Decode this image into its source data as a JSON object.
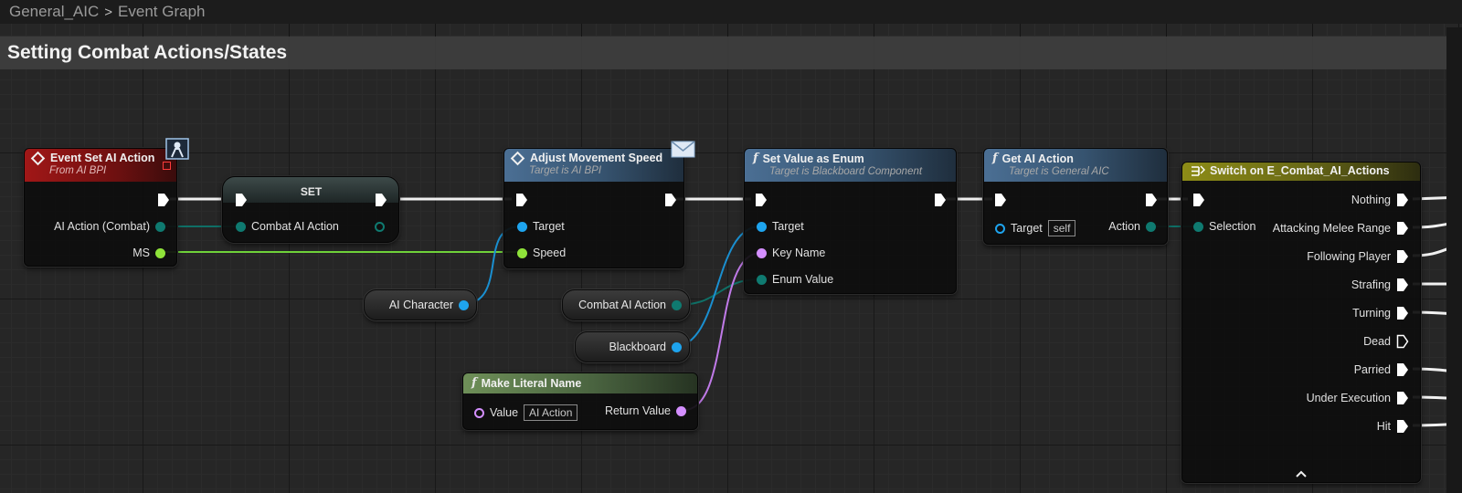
{
  "breadcrumb": {
    "graph_name": "General_AIC",
    "separator": ">",
    "current": "Event Graph"
  },
  "comment": {
    "title": "Setting Combat Actions/States"
  },
  "nodes": {
    "event_set_ai_action": {
      "title": "Event Set AI Action",
      "subtitle": "From AI BPI",
      "pins": {
        "ai_action": "AI Action (Combat)",
        "ms": "MS"
      }
    },
    "set_node": {
      "title": "SET",
      "pins": {
        "combat_ai_action": "Combat AI Action"
      }
    },
    "adjust_movement_speed": {
      "title": "Adjust Movement Speed",
      "subtitle": "Target is AI BPI",
      "pins": {
        "target": "Target",
        "speed": "Speed"
      }
    },
    "set_value_as_enum": {
      "title": "Set Value as Enum",
      "subtitle": "Target is Blackboard Component",
      "pins": {
        "target": "Target",
        "key_name": "Key Name",
        "enum_value": "Enum Value"
      }
    },
    "get_ai_action": {
      "title": "Get AI Action",
      "subtitle": "Target is General AIC",
      "pins": {
        "target": "Target",
        "target_value": "self",
        "action": "Action"
      }
    },
    "switch_node": {
      "title": "Switch on E_Combat_AI_Actions",
      "selection": "Selection",
      "outputs": [
        "Nothing",
        "Attacking Melee Range",
        "Following Player",
        "Strafing",
        "Turning",
        "Dead",
        "Parried",
        "Under Execution",
        "Hit"
      ]
    },
    "make_literal_name": {
      "title": "Make Literal Name",
      "pins": {
        "value": "Value",
        "value_default": "AI Action",
        "return_value": "Return Value"
      }
    },
    "var_ai_character": {
      "label": "AI Character"
    },
    "var_combat_ai_action": {
      "label": "Combat AI Action"
    },
    "var_blackboard": {
      "label": "Blackboard"
    }
  },
  "colors": {
    "exec": "#ffffff",
    "enum_pin": "#0f7a70",
    "float_pin": "#8fe33a",
    "object_pin": "#1ea4ee",
    "name_pin": "#d48fff"
  }
}
